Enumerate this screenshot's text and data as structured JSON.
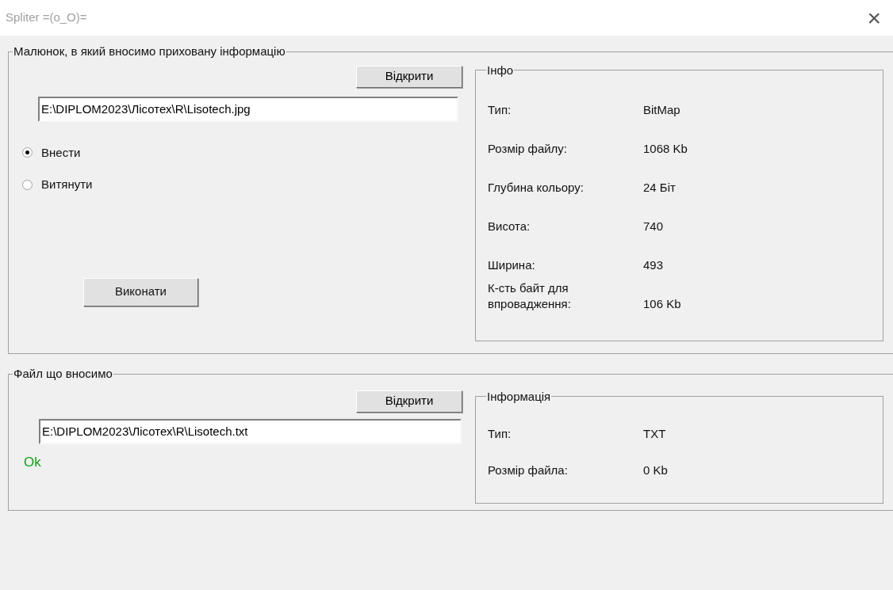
{
  "window": {
    "title": "Spliter =(o_O)=",
    "close": "×"
  },
  "image_group": {
    "title": "Малюнок, в який вносимо приховану інформацію",
    "open_button": "Відкрити",
    "path": "E:\\DIPLOM2023\\Лісотех\\R\\Lisotech.jpg",
    "modes": [
      {
        "label": "Внести",
        "selected": true
      },
      {
        "label": "Витянути",
        "selected": false
      }
    ],
    "run_button": "Виконати",
    "info": {
      "title": "Інфо",
      "rows": [
        {
          "label": "Тип:",
          "value": "BitMap"
        },
        {
          "label": "Розмір файлу:",
          "value": "1068 Kb"
        },
        {
          "label": "Глубина кольору:",
          "value": "24 Біт"
        },
        {
          "label": "Висота:",
          "value": "740"
        },
        {
          "label": "Ширина:",
          "value": "493"
        },
        {
          "label": "К-сть байт для впровадження:",
          "value": "106 Kb"
        }
      ]
    }
  },
  "file_group": {
    "title": "Файл що вносимо",
    "open_button": "Відкрити",
    "path": "E:\\DIPLOM2023\\Лісотех\\R\\Lisotech.txt",
    "status": {
      "text": "Ok",
      "kind": "success"
    },
    "info": {
      "title": "Інформація",
      "rows": [
        {
          "label": "Тип:",
          "value": "TXT"
        },
        {
          "label": "Розмір файла:",
          "value": "0 Kb"
        }
      ]
    }
  }
}
